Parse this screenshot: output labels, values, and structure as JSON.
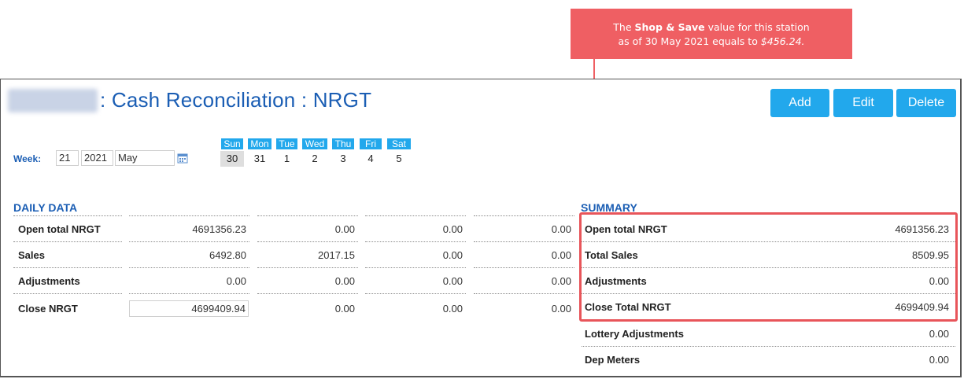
{
  "callout": {
    "text_prefix": "The",
    "text_bold": "Shop & Save",
    "text_mid": "value for this station",
    "text_line2": "as of 30 May 2021 equals to",
    "text_value": "$456.24."
  },
  "header": {
    "station_name": "Cochran",
    "title": ": Cash Reconciliation : NRGT"
  },
  "buttons": {
    "add": "Add",
    "edit": "Edit",
    "delete": "Delete"
  },
  "week": {
    "label": "Week:",
    "number": "21",
    "year": "2021",
    "month": "May",
    "days": [
      {
        "name": "Sun",
        "date": "30"
      },
      {
        "name": "Mon",
        "date": "31"
      },
      {
        "name": "Tue",
        "date": "1"
      },
      {
        "name": "Wed",
        "date": "2"
      },
      {
        "name": "Thu",
        "date": "3"
      },
      {
        "name": "Fri",
        "date": "4"
      },
      {
        "name": "Sat",
        "date": "5"
      }
    ]
  },
  "daily": {
    "title": "DAILY DATA",
    "rows": [
      {
        "label": "Open total NRGT",
        "values": [
          "4691356.23",
          "0.00",
          "0.00",
          "0.00"
        ]
      },
      {
        "label": "Sales",
        "values": [
          "6492.80",
          "2017.15",
          "0.00",
          "0.00"
        ]
      },
      {
        "label": "Adjustments",
        "values": [
          "0.00",
          "0.00",
          "0.00",
          "0.00"
        ]
      },
      {
        "label": "Close NRGT",
        "values": [
          "4699409.94",
          "0.00",
          "0.00",
          "0.00"
        ]
      }
    ]
  },
  "summary": {
    "title": "SUMMARY",
    "rows": [
      {
        "label": "Open total NRGT",
        "value": "4691356.23"
      },
      {
        "label": "Total Sales",
        "value": "8509.95"
      },
      {
        "label": "Adjustments",
        "value": "0.00"
      },
      {
        "label": "Close Total NRGT",
        "value": "4699409.94"
      },
      {
        "label": "Lottery Adjustments",
        "value": "0.00"
      },
      {
        "label": "Dep Meters",
        "value": "0.00"
      }
    ]
  },
  "colors": {
    "accent": "#22a8ec",
    "title_blue": "#1b5eb4",
    "callout_red": "#ef5f63",
    "highlight_red": "#e8555a"
  }
}
